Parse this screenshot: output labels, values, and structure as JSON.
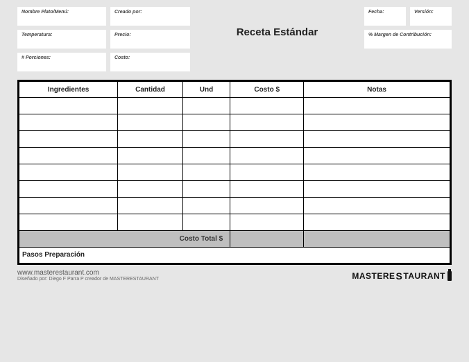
{
  "title": "Receta Estándar",
  "fields": {
    "nombre": "Nombre Plato/Menú:",
    "creado": "Creado por:",
    "temperatura": "Temperatura:",
    "precio": "Precio:",
    "porciones": "# Porciones:",
    "costo": "Costo:",
    "fecha": "Fecha:",
    "version": "Versión:",
    "margen": "% Margen de Contribución:"
  },
  "table": {
    "headers": {
      "ingredientes": "Ingredientes",
      "cantidad": "Cantidad",
      "und": "Und",
      "costo": "Costo $",
      "notas": "Notas"
    },
    "total_label": "Costo Total $",
    "prep_label": "Pasos Preparación"
  },
  "footer": {
    "url": "www.masterestaurant.com",
    "credit": "Diseñado por: Diego F Parra P creador de MASTERESTAURANT",
    "logo_a": "MASTERE",
    "logo_s": "S",
    "logo_b": "TAURANT"
  }
}
